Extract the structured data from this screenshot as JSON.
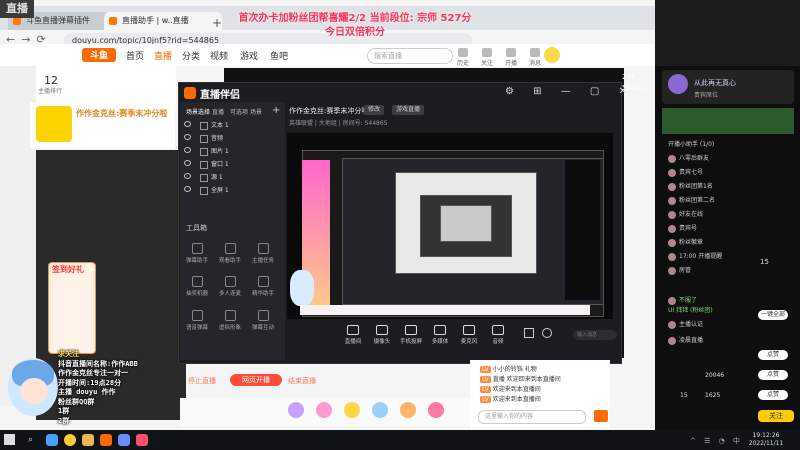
{
  "overlay": {
    "corner_logo": "直播",
    "line1": "首次办卡加粉丝团帮喜耀2/2  当前段位: 宗师 527分",
    "line2": "今日双倍积分"
  },
  "browser": {
    "tab1": "斗鱼直播弹幕插件",
    "tab2": "直播助手 | w..直播",
    "url": "douyu.com/topic/10jnf5?rid=544865"
  },
  "douyu": {
    "logo": "斗鱼",
    "nav": [
      "首页",
      "直播",
      "分类",
      "视频",
      "游戏",
      "鱼吧"
    ],
    "search_placeholder": "搜索直播",
    "top_icons": [
      "历史",
      "关注",
      "开播",
      "消息",
      "充值",
      "下载"
    ],
    "sub_count": "12",
    "sub_label": "主播排行",
    "anchor_title": "作作金克丝:赛季末冲分啦",
    "checkin_title": "签到好礼",
    "overlay_caption": [
      "求关注",
      "抖音直播间名称:作作ABB",
      "作作金克丝专注一对一",
      "开播时间:19点28分",
      "主播 douyu 作作",
      "粉丝群QQ群",
      "1群",
      "2群"
    ],
    "gifts_count": "8"
  },
  "right_panel": {
    "viewers": "225",
    "fans": "56471",
    "rank_label": "从此再无真心",
    "sub_rank": "贵宾席位",
    "rows": [
      "开播小助手 (1/0)",
      "八零后群友",
      "贵宾七号",
      "粉丝团第1名",
      "粉丝团第二名",
      "好友在线",
      "贵宾号",
      "粉丝徽章",
      "17:00 开播提醒",
      "房管",
      "不服了",
      "UI 拜拜 (粉丝团)",
      "主播认证",
      "凌晨直播"
    ],
    "buttons": [
      "一键全部",
      "点赞",
      "点赞",
      "点赞",
      "关注"
    ],
    "nums": [
      "15",
      "20046",
      "15",
      "1625"
    ],
    "yellow_btn": "关注"
  },
  "zb": {
    "app_name": "直播伴侣",
    "tabs": [
      "场景选择",
      "直播",
      "可选项",
      "场景"
    ],
    "scenes": [
      "文本 1",
      "音频",
      "图片 1",
      "窗口 1",
      "源 1",
      "全屏 1"
    ],
    "tools_label": "工具箱",
    "tools": [
      "弹幕助手",
      "观看助手",
      "主播任务",
      "抽奖机器",
      "多人连麦",
      "精华助手",
      "语音弹幕",
      "虚拟形象",
      "弹幕互动"
    ],
    "stream_title": "作作金克丝:赛季末冲分啦",
    "tagA": "修改",
    "tagB": "游戏直播",
    "sub": "英雄联盟  | 大地组   | 房间号: 544865",
    "bottom": [
      "直播间",
      "摄像头",
      "手机投屏",
      "多媒体",
      "麦克风",
      "音频"
    ],
    "input_placeholder": "输入消息",
    "live_a": "停止直播",
    "live_btn": "网页开播",
    "live_c": "结束直播"
  },
  "chat": {
    "lines": [
      "小小的铃铛  礼物",
      "直播 欢迎回来到本直播间",
      "欢迎来到本直播间",
      "欢迎来到本直播间"
    ],
    "input_placeholder": "这里输入你的内容"
  },
  "taskbar": {
    "time": "19:12:26",
    "date": "2022/11/11"
  }
}
